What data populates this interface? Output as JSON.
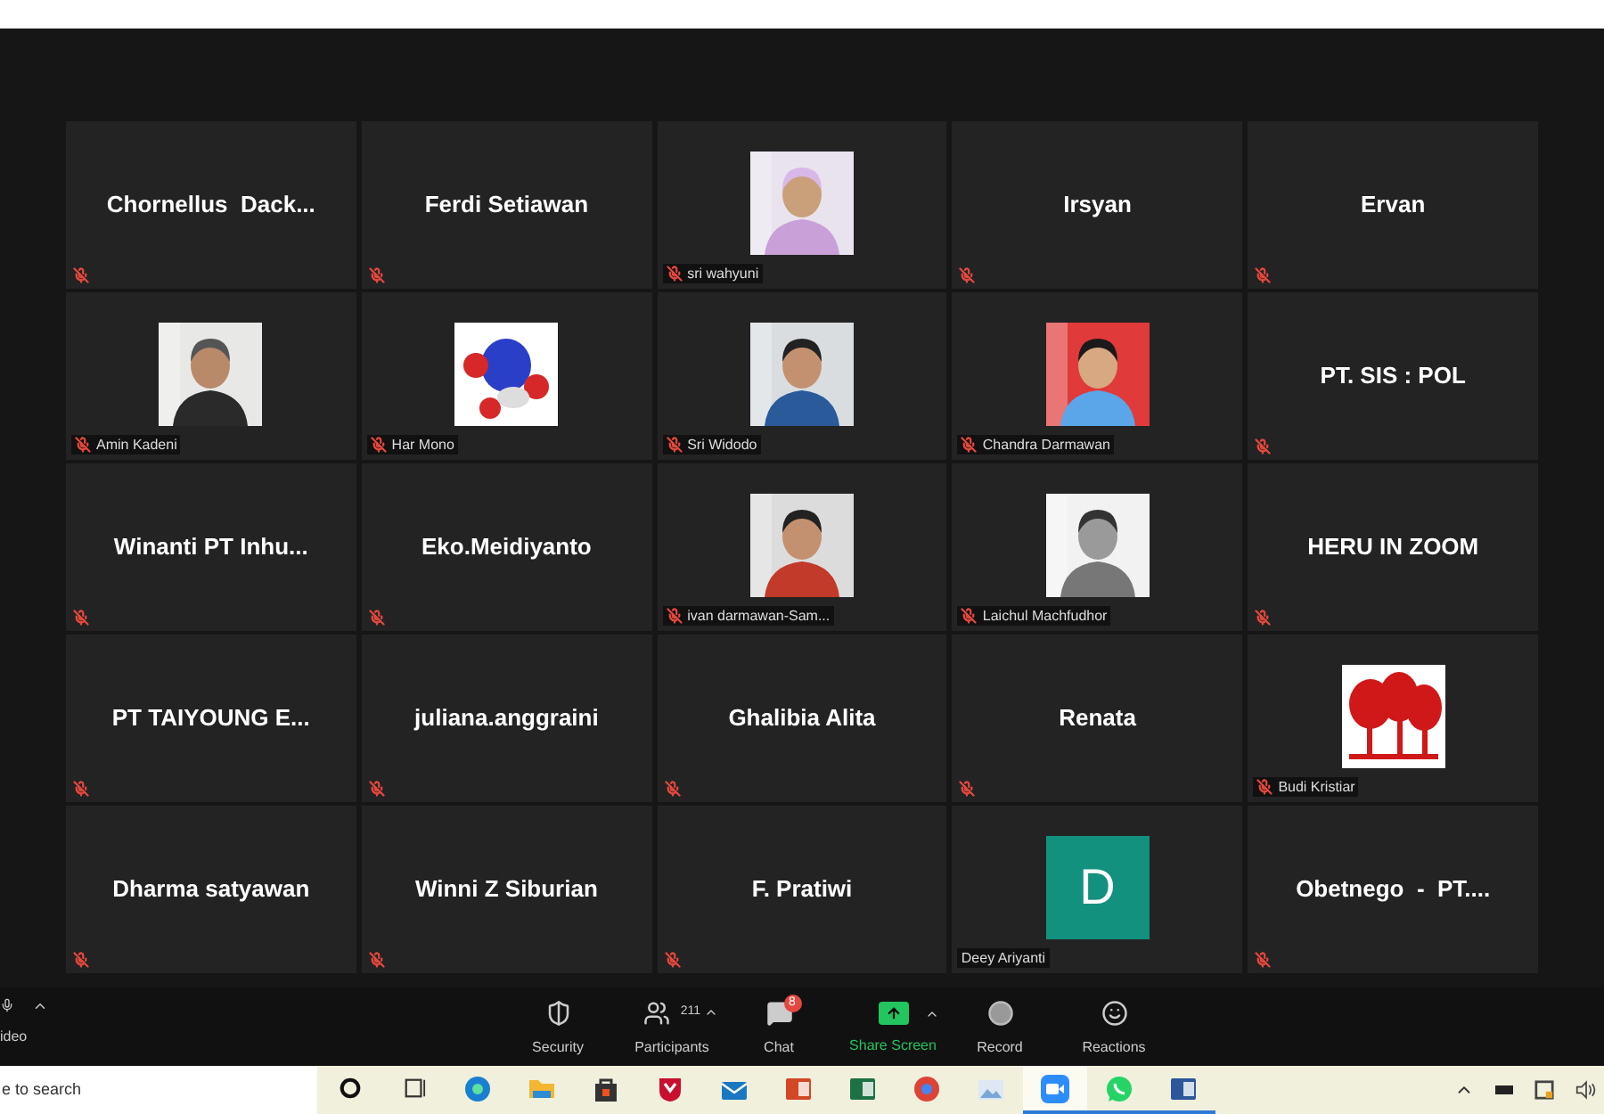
{
  "gallery": [
    {
      "kind": "name",
      "name": "Chornellus  Dack...",
      "muted": true
    },
    {
      "kind": "name",
      "name": "Ferdi Setiawan",
      "muted": true
    },
    {
      "name": "sri wahyuni",
      "muted": true
    },
    {
      "kind": "name",
      "name": "Irsyan",
      "muted": true
    },
    {
      "kind": "name",
      "name": "Ervan",
      "muted": true
    },
    {
      "name": "Amin Kadeni",
      "muted": true
    },
    {
      "name": "Har Mono",
      "muted": true
    },
    {
      "name": "Sri Widodo",
      "muted": true
    },
    {
      "name": "Chandra Darmawan",
      "muted": true
    },
    {
      "kind": "name",
      "name": "PT. SIS : POL",
      "muted": true
    },
    {
      "kind": "name",
      "name": "Winanti PT Inhu...",
      "muted": true
    },
    {
      "kind": "name",
      "name": "Eko.Meidiyanto",
      "muted": true
    },
    {
      "name": "ivan darmawan-Sam...",
      "muted": true
    },
    {
      "name": "Laichul Machfudhor",
      "muted": true
    },
    {
      "kind": "name",
      "name": "HERU IN ZOOM",
      "muted": true
    },
    {
      "kind": "name",
      "name": "PT TAIYOUNG E...",
      "muted": true
    },
    {
      "kind": "name",
      "name": "juliana.anggraini",
      "muted": true
    },
    {
      "kind": "name",
      "name": "Ghalibia Alita",
      "muted": true
    },
    {
      "kind": "name",
      "name": "Renata",
      "muted": true
    },
    {
      "name": "Budi Kristiar",
      "muted": true
    },
    {
      "kind": "name",
      "name": "Dharma satyawan",
      "muted": true
    },
    {
      "kind": "name",
      "name": "Winni Z Siburian",
      "muted": true
    },
    {
      "kind": "name",
      "name": "F. Pratiwi",
      "muted": true
    },
    {
      "kind": "avatar",
      "name": "Deey Ariyanti",
      "letter": "D",
      "color": "#12917e",
      "muted": false
    },
    {
      "kind": "name",
      "name": "Obetnego  -  PT....",
      "muted": true
    }
  ],
  "toolbar": {
    "left_label": "ideo",
    "items": [
      {
        "kind": "security",
        "label": "Security"
      },
      {
        "kind": "participants",
        "label": "Participants",
        "count": "211"
      },
      {
        "kind": "chat",
        "label": "Chat",
        "badge": "8"
      },
      {
        "kind": "share",
        "label": "Share Screen"
      },
      {
        "kind": "record",
        "label": "Record"
      },
      {
        "kind": "reactions",
        "label": "Reactions"
      }
    ]
  },
  "taskbar": {
    "search_placeholder": "e to search",
    "apps": [
      {
        "running": false,
        "selected": false
      },
      {
        "running": false,
        "selected": false
      },
      {
        "running": false,
        "selected": false
      },
      {
        "running": false,
        "selected": false
      },
      {
        "running": false,
        "selected": false
      },
      {
        "running": false,
        "selected": false
      },
      {
        "running": false,
        "selected": false
      },
      {
        "running": false,
        "selected": false
      },
      {
        "running": false,
        "selected": false
      },
      {
        "running": false,
        "selected": false
      },
      {
        "running": false,
        "selected": false
      },
      {
        "running": true,
        "selected": true
      },
      {
        "running": true,
        "selected": false
      },
      {
        "running": true,
        "selected": false
      }
    ]
  }
}
